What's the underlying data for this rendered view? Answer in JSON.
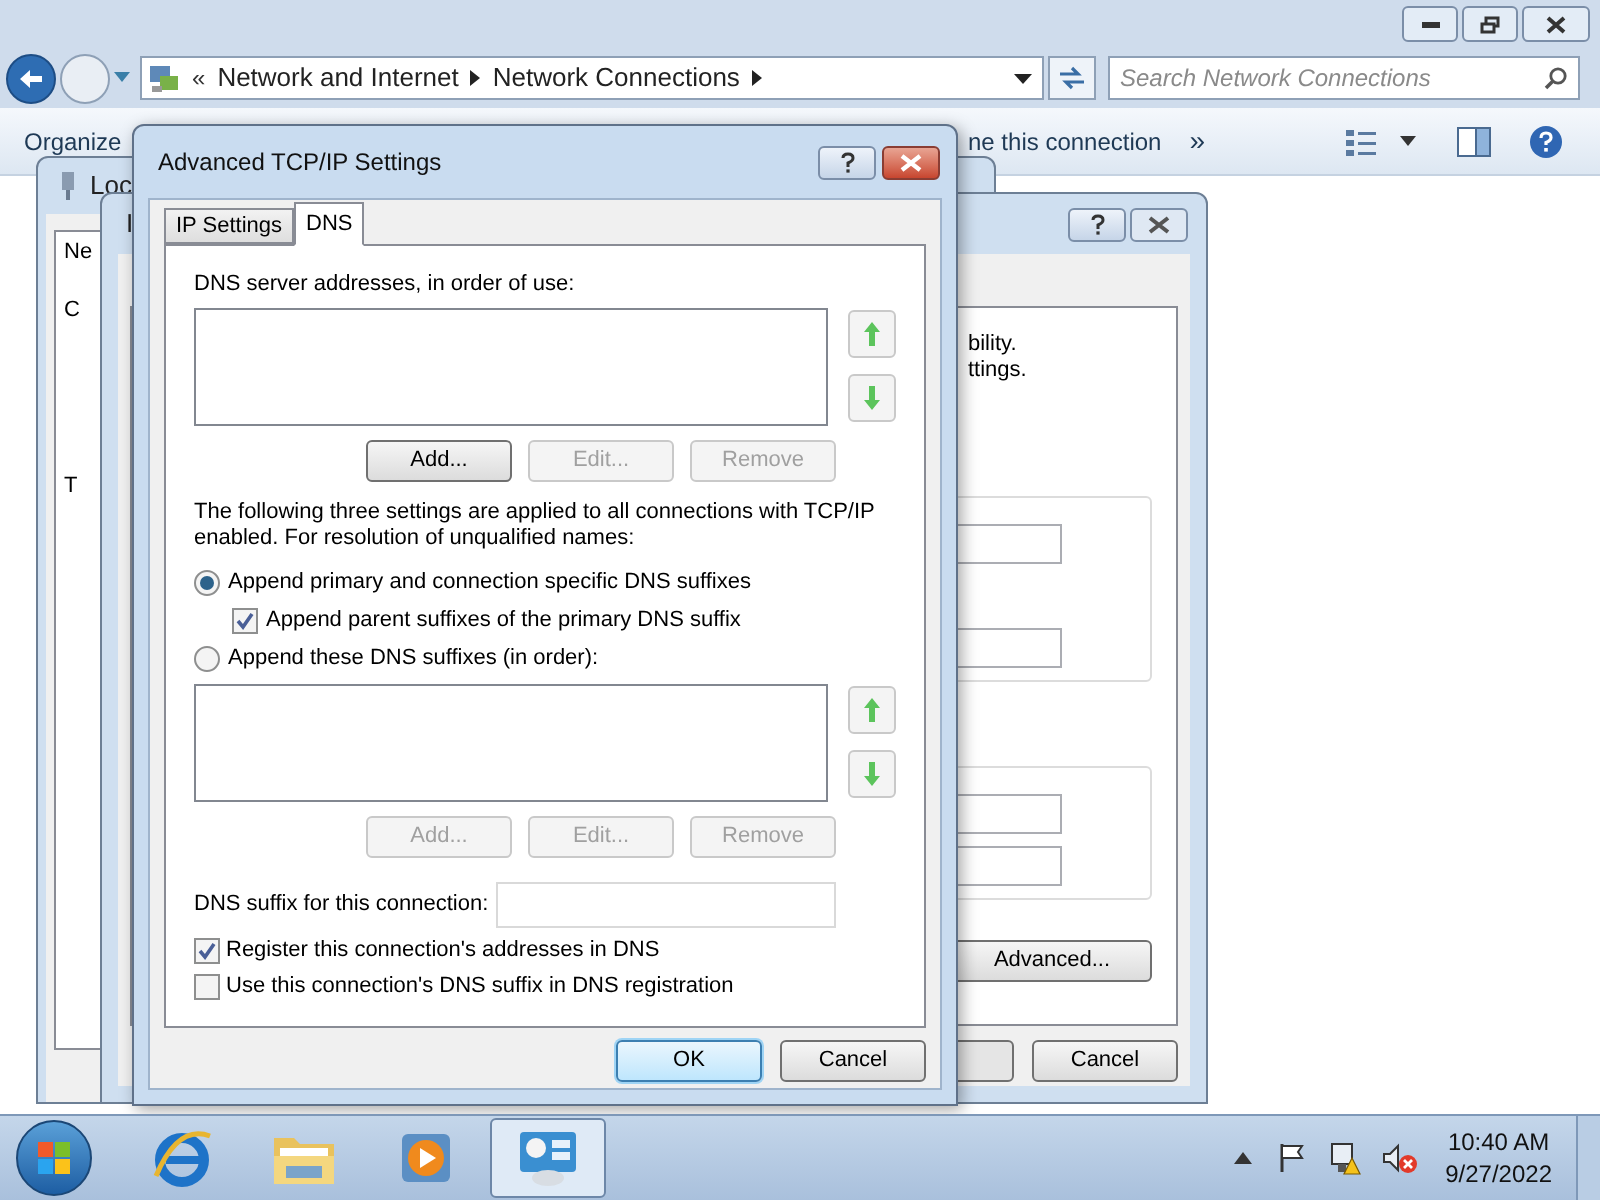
{
  "explorer": {
    "overflow": "«",
    "breadcrumb": [
      "Network and Internet",
      "Network Connections"
    ],
    "search": {
      "placeholder": "Search Network Connections"
    },
    "toolbar": [
      "Organize",
      "ne this connection"
    ],
    "more": "»"
  },
  "local_window": {
    "title": "Loc",
    "tab": "Ne",
    "labels": [
      "C",
      "T"
    ]
  },
  "properties_window": {
    "title": "I",
    "texts": [
      "bility.",
      "ttings."
    ],
    "advanced_button": "Advanced...",
    "cancel_button": "Cancel"
  },
  "dialog": {
    "title": "Advanced TCP/IP Settings",
    "tabs": [
      {
        "label": "IP Settings",
        "selected": false
      },
      {
        "label": "DNS",
        "selected": true
      }
    ],
    "servers_label": "DNS server addresses, in order of use:",
    "server_buttons": [
      {
        "label": "Add...",
        "disabled": false
      },
      {
        "label": "Edit...",
        "disabled": true
      },
      {
        "label": "Remove",
        "disabled": true
      }
    ],
    "note": "The following three settings are applied to all connections with TCP/IP enabled. For resolution of unqualified names:",
    "options": [
      {
        "label": "Append primary and connection specific DNS suffixes",
        "selected": true,
        "children": [
          {
            "label": "Append parent suffixes of the primary DNS suffix",
            "checked": true
          }
        ]
      },
      {
        "label": "Append these DNS suffixes (in order):",
        "selected": false
      }
    ],
    "suffix_buttons": [
      {
        "label": "Add...",
        "disabled": true
      },
      {
        "label": "Edit...",
        "disabled": true
      },
      {
        "label": "Remove",
        "disabled": true
      }
    ],
    "suffix_label": "DNS suffix for this connection:",
    "checkboxes": [
      {
        "label": "Register this connection's addresses in DNS",
        "checked": true
      },
      {
        "label": "Use this connection's DNS suffix in DNS registration",
        "checked": false
      }
    ],
    "ok": "OK",
    "cancel": "Cancel"
  },
  "taskbar": {
    "programs": [
      {
        "kind": "browser",
        "selected": false
      },
      {
        "kind": "folder",
        "selected": false
      },
      {
        "kind": "media",
        "selected": false
      },
      {
        "kind": "control-panel",
        "selected": true
      }
    ],
    "time": "10:40 AM",
    "date": "9/27/2022"
  }
}
